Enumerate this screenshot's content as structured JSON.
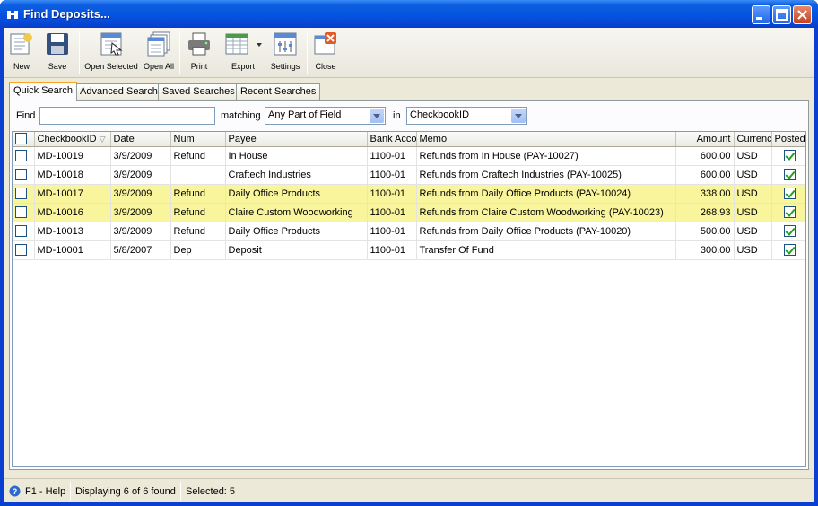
{
  "window": {
    "title": "Find Deposits..."
  },
  "toolbar": {
    "items": [
      {
        "label": "New",
        "icon": "new-document-icon"
      },
      {
        "label": "Save",
        "icon": "save-disk-icon"
      },
      {
        "label": "Open Selected",
        "icon": "open-selected-icon"
      },
      {
        "label": "Open All",
        "icon": "open-all-icon"
      },
      {
        "label": "Print",
        "icon": "printer-icon"
      },
      {
        "label": "Export",
        "icon": "export-icon"
      },
      {
        "label": "Settings",
        "icon": "settings-icon"
      },
      {
        "label": "Close",
        "icon": "close-icon"
      }
    ]
  },
  "tabs": [
    "Quick Search",
    "Advanced Search",
    "Saved Searches",
    "Recent Searches"
  ],
  "active_tab": "Quick Search",
  "search": {
    "find_label": "Find",
    "find_value": "",
    "matching_label": "matching",
    "matching_value": "Any Part of Field",
    "in_label": "in",
    "in_value": "CheckbookID"
  },
  "grid": {
    "columns": [
      "CheckbookID",
      "Date",
      "Num",
      "Payee",
      "Bank Acco",
      "Memo",
      "Amount",
      "Currenc",
      "Posted"
    ],
    "rows": [
      {
        "checkbook": "MD-10019",
        "date": "3/9/2009",
        "num": "Refund",
        "payee": "In House",
        "bank": "1100-01",
        "memo": "Refunds from In House (PAY-10027)",
        "amount": "600.00",
        "currency": "USD",
        "posted": true,
        "selected": false
      },
      {
        "checkbook": "MD-10018",
        "date": "3/9/2009",
        "num": "",
        "payee": "Craftech Industries",
        "bank": "1100-01",
        "memo": "Refunds from Craftech Industries (PAY-10025)",
        "amount": "600.00",
        "currency": "USD",
        "posted": true,
        "selected": false
      },
      {
        "checkbook": "MD-10017",
        "date": "3/9/2009",
        "num": "Refund",
        "payee": "Daily Office Products",
        "bank": "1100-01",
        "memo": "Refunds from Daily Office Products (PAY-10024)",
        "amount": "338.00",
        "currency": "USD",
        "posted": true,
        "selected": true
      },
      {
        "checkbook": "MD-10016",
        "date": "3/9/2009",
        "num": "Refund",
        "payee": "Claire Custom Woodworking",
        "bank": "1100-01",
        "memo": "Refunds from Claire Custom Woodworking (PAY-10023)",
        "amount": "268.93",
        "currency": "USD",
        "posted": true,
        "selected": true
      },
      {
        "checkbook": "MD-10013",
        "date": "3/9/2009",
        "num": "Refund",
        "payee": "Daily Office Products",
        "bank": "1100-01",
        "memo": "Refunds from Daily Office Products (PAY-10020)",
        "amount": "500.00",
        "currency": "USD",
        "posted": true,
        "selected": false
      },
      {
        "checkbook": "MD-10001",
        "date": "5/8/2007",
        "num": "Dep",
        "payee": "Deposit",
        "bank": "1100-01",
        "memo": "Transfer Of Fund",
        "amount": "300.00",
        "currency": "USD",
        "posted": true,
        "selected": false
      }
    ]
  },
  "status": {
    "help": "F1 - Help",
    "displaying": "Displaying 6 of 6 found",
    "selected": "Selected: 5"
  },
  "colors": {
    "selected_row": "#f8f59c",
    "active_tab_accent": "#f5a623",
    "titlebar": "#0553e0"
  }
}
